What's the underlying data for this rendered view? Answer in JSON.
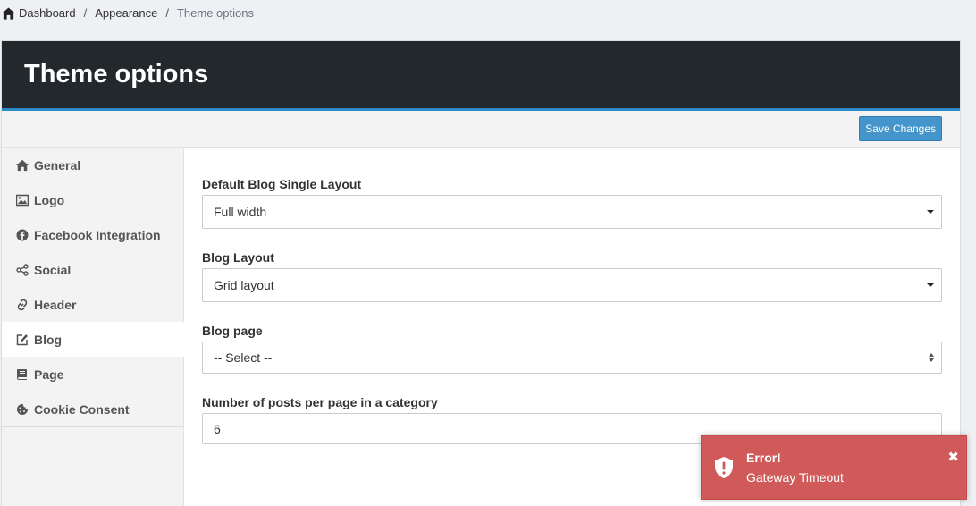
{
  "breadcrumb": {
    "items": [
      {
        "label": "Dashboard",
        "icon": "home-icon"
      },
      {
        "label": "Appearance"
      },
      {
        "label": "Theme options"
      }
    ],
    "separator": "/"
  },
  "page": {
    "title": "Theme options",
    "save_label": "Save Changes"
  },
  "sidebar": {
    "items": [
      {
        "label": "General",
        "icon": "home-icon"
      },
      {
        "label": "Logo",
        "icon": "image-icon"
      },
      {
        "label": "Facebook Integration",
        "icon": "facebook-icon"
      },
      {
        "label": "Social",
        "icon": "share-icon"
      },
      {
        "label": "Header",
        "icon": "link-icon"
      },
      {
        "label": "Blog",
        "icon": "edit-icon",
        "active": true
      },
      {
        "label": "Page",
        "icon": "book-icon"
      },
      {
        "label": "Cookie Consent",
        "icon": "cookie-icon"
      }
    ]
  },
  "form": {
    "blog_single_layout": {
      "label": "Default Blog Single Layout",
      "value": "Full width"
    },
    "blog_layout": {
      "label": "Blog Layout",
      "value": "Grid layout"
    },
    "blog_page": {
      "label": "Blog page",
      "value": "-- Select --"
    },
    "posts_per_page": {
      "label": "Number of posts per page in a category",
      "value": "6"
    }
  },
  "toast": {
    "title": "Error!",
    "message": "Gateway Timeout",
    "close": "✖",
    "color": "#d05a5a",
    "icon": "shield-exclamation-icon"
  },
  "colors": {
    "header_bg": "#23282d",
    "accent": "#2a8ac6",
    "button": "#4495cb"
  }
}
